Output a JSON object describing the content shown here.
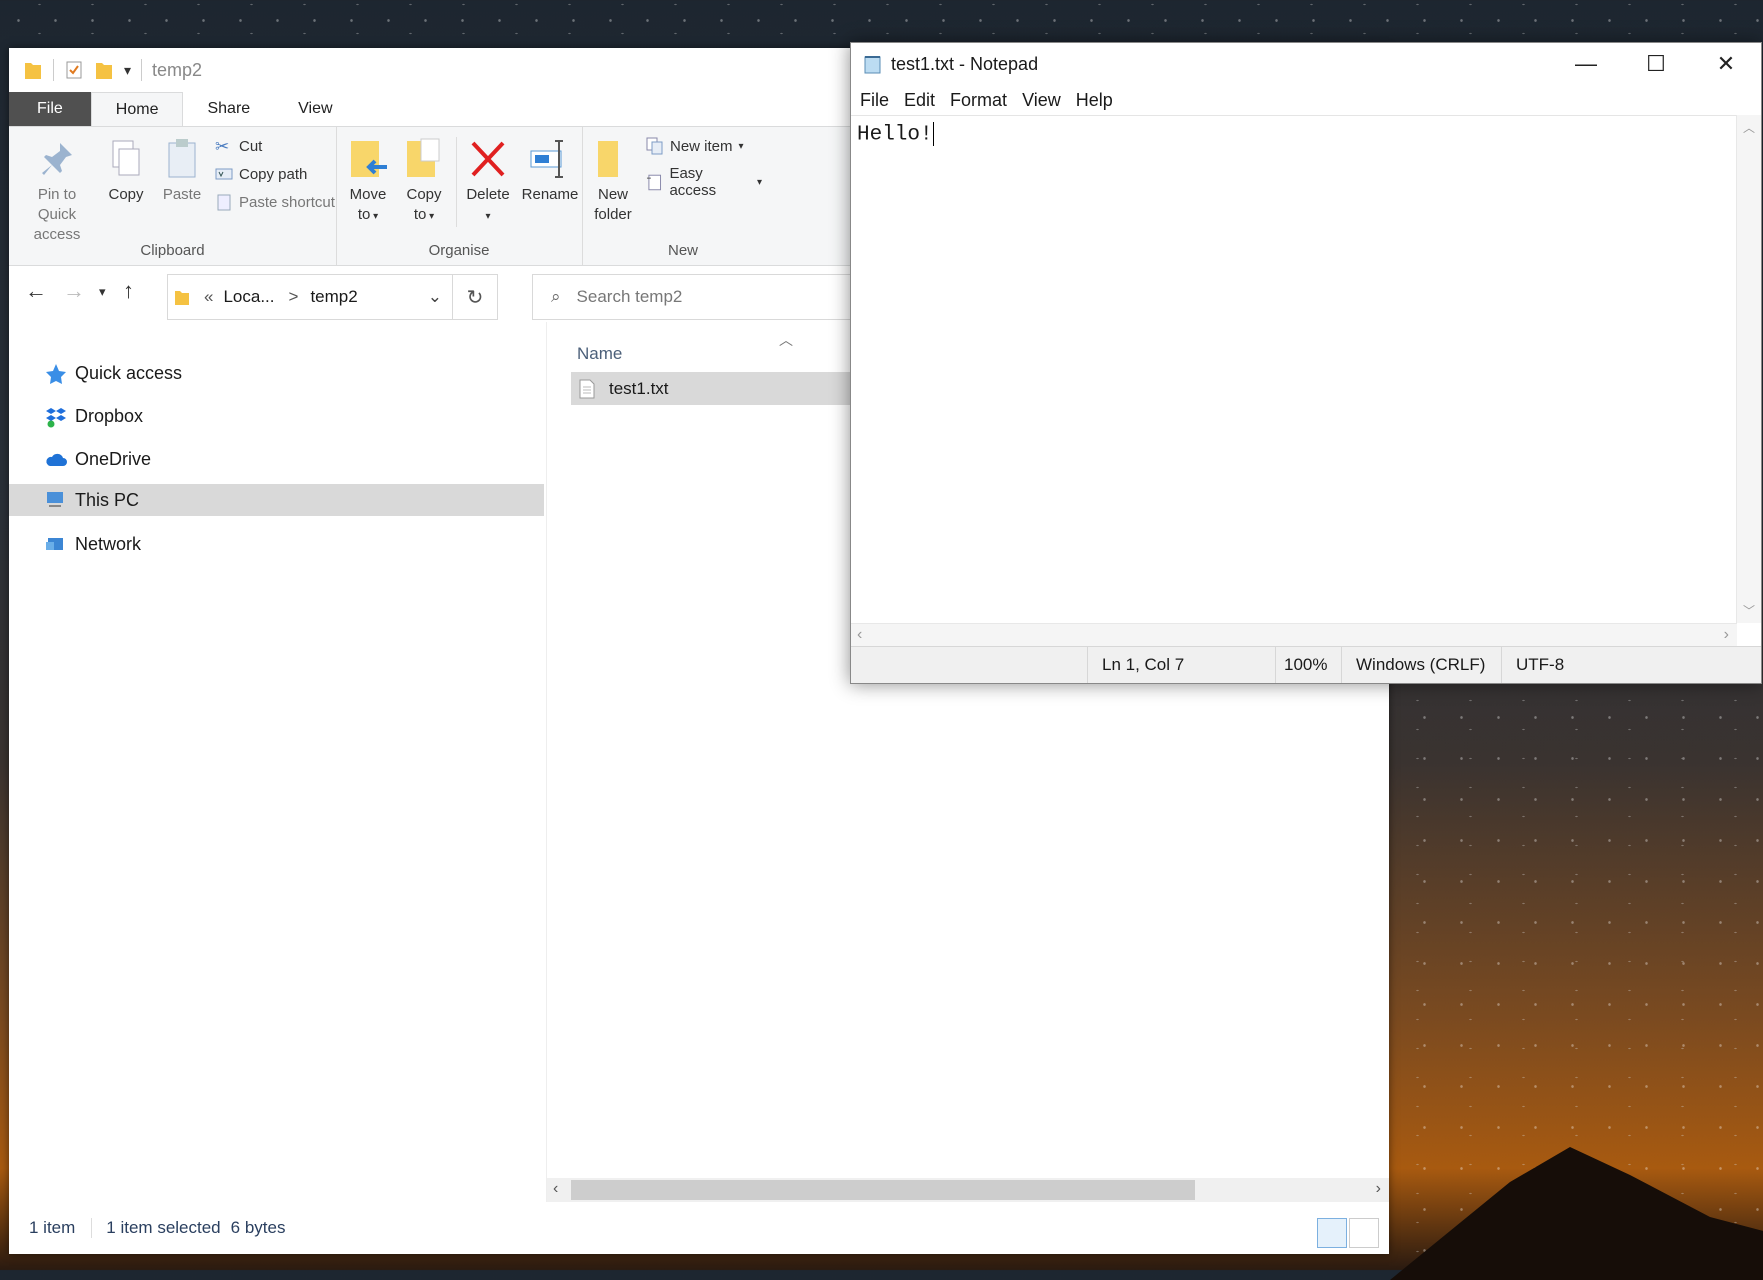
{
  "explorer": {
    "qat_title": "temp2",
    "tabs": {
      "file": "File",
      "home": "Home",
      "share": "Share",
      "view": "View"
    },
    "ribbon": {
      "clipboard": {
        "label": "Clipboard",
        "pin": "Pin to Quick access",
        "copy": "Copy",
        "paste": "Paste",
        "cut": "Cut",
        "copy_path": "Copy path",
        "paste_shortcut": "Paste shortcut"
      },
      "organise": {
        "label": "Organise",
        "move_to_l1": "Move",
        "move_to_l2": "to",
        "copy_to_l1": "Copy",
        "copy_to_l2": "to",
        "delete": "Delete",
        "rename": "Rename"
      },
      "new": {
        "label": "New",
        "new_folder_l1": "New",
        "new_folder_l2": "folder",
        "new_item": "New item",
        "easy_access": "Easy access"
      }
    },
    "address": {
      "prefix": "«",
      "crumb1": "Loca...",
      "sep": ">",
      "crumb2": "temp2"
    },
    "search_placeholder": "Search temp2",
    "nav": [
      {
        "label": "Quick access"
      },
      {
        "label": "Dropbox"
      },
      {
        "label": "OneDrive"
      },
      {
        "label": "This PC"
      },
      {
        "label": "Network"
      }
    ],
    "column_name": "Name",
    "files": [
      {
        "name": "test1.txt"
      }
    ],
    "status": {
      "count": "1 item",
      "selected": "1 item selected",
      "size": "6 bytes"
    }
  },
  "notepad": {
    "title": "test1.txt - Notepad",
    "menu": {
      "file": "File",
      "edit": "Edit",
      "format": "Format",
      "view": "View",
      "help": "Help"
    },
    "content": "Hello!",
    "status": {
      "position": "Ln 1, Col 7",
      "zoom": "100%",
      "line_ending": "Windows (CRLF)",
      "encoding": "UTF-8"
    }
  }
}
